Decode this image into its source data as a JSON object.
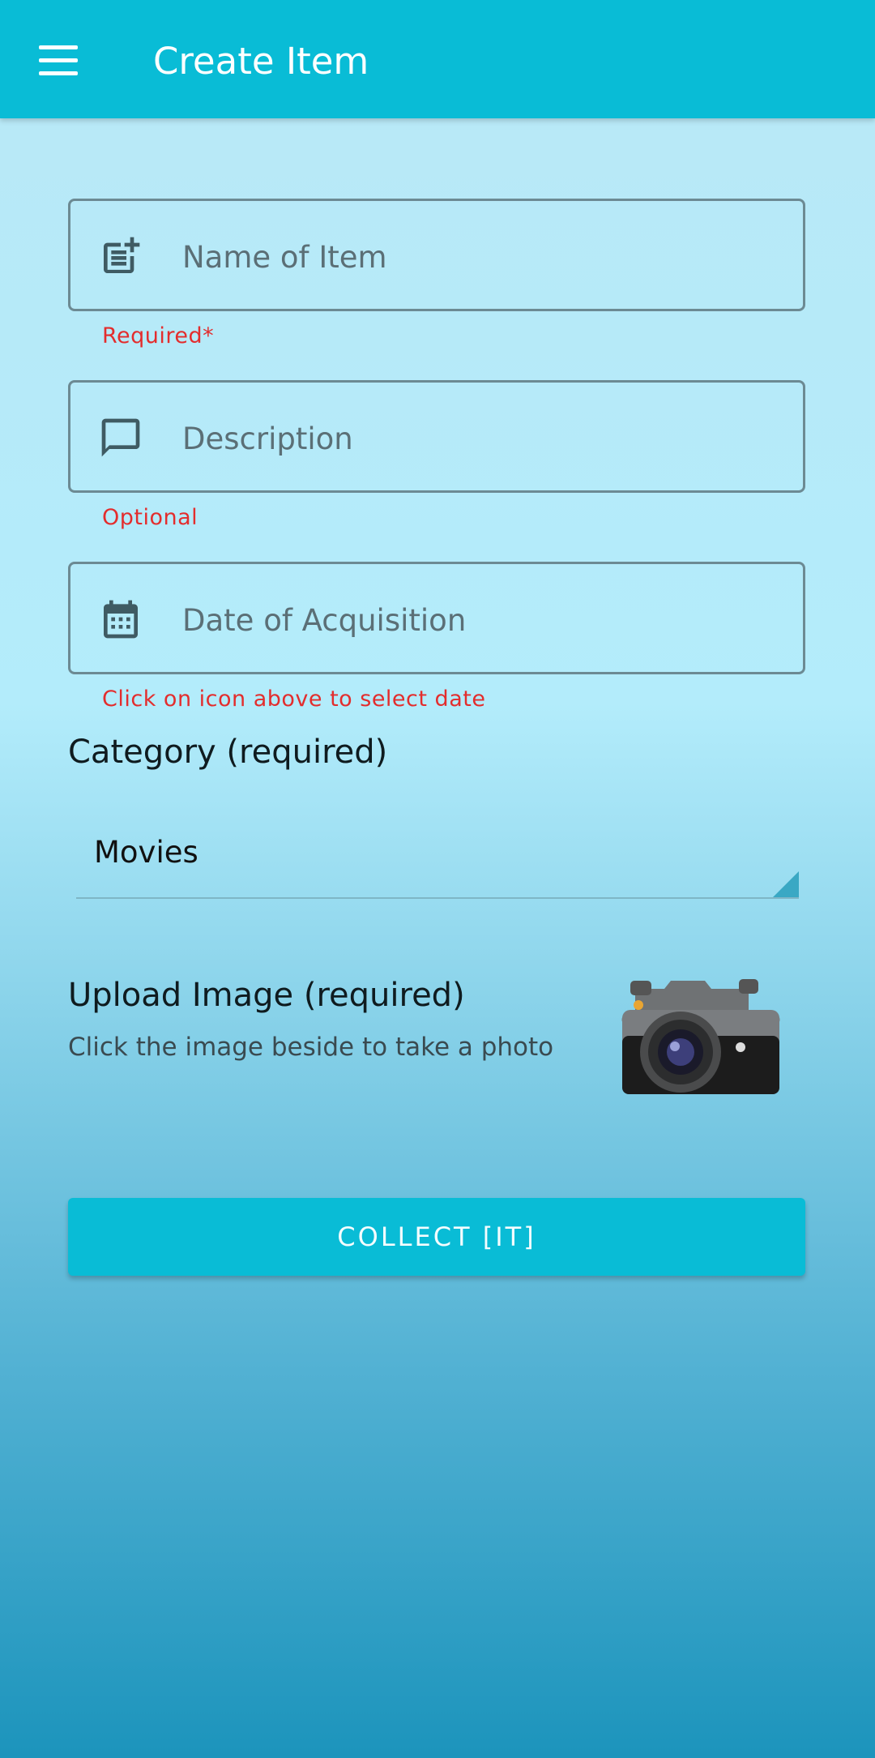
{
  "appbar": {
    "title": "Create Item",
    "menu_icon": "menu-icon"
  },
  "form": {
    "name": {
      "placeholder": "Name of Item",
      "value": "",
      "helper": "Required*",
      "icon": "post-add-icon"
    },
    "description": {
      "placeholder": "Description",
      "value": "",
      "helper": "Optional",
      "icon": "comment-icon"
    },
    "date": {
      "placeholder": "Date of Acquisition",
      "value": "",
      "helper": "Click on icon above to select date",
      "icon": "calendar-icon"
    },
    "category": {
      "label": "Category (required)",
      "selected": "Movies"
    },
    "upload": {
      "title": "Upload Image (required)",
      "hint": "Click the image beside to take a photo",
      "icon": "camera-icon"
    },
    "submit_label": "COLLECT [IT]"
  },
  "colors": {
    "appbar": "#09bcd6",
    "button": "#09bcd6",
    "helper_text": "#e32d2d",
    "field_border": "#6c8a93"
  }
}
